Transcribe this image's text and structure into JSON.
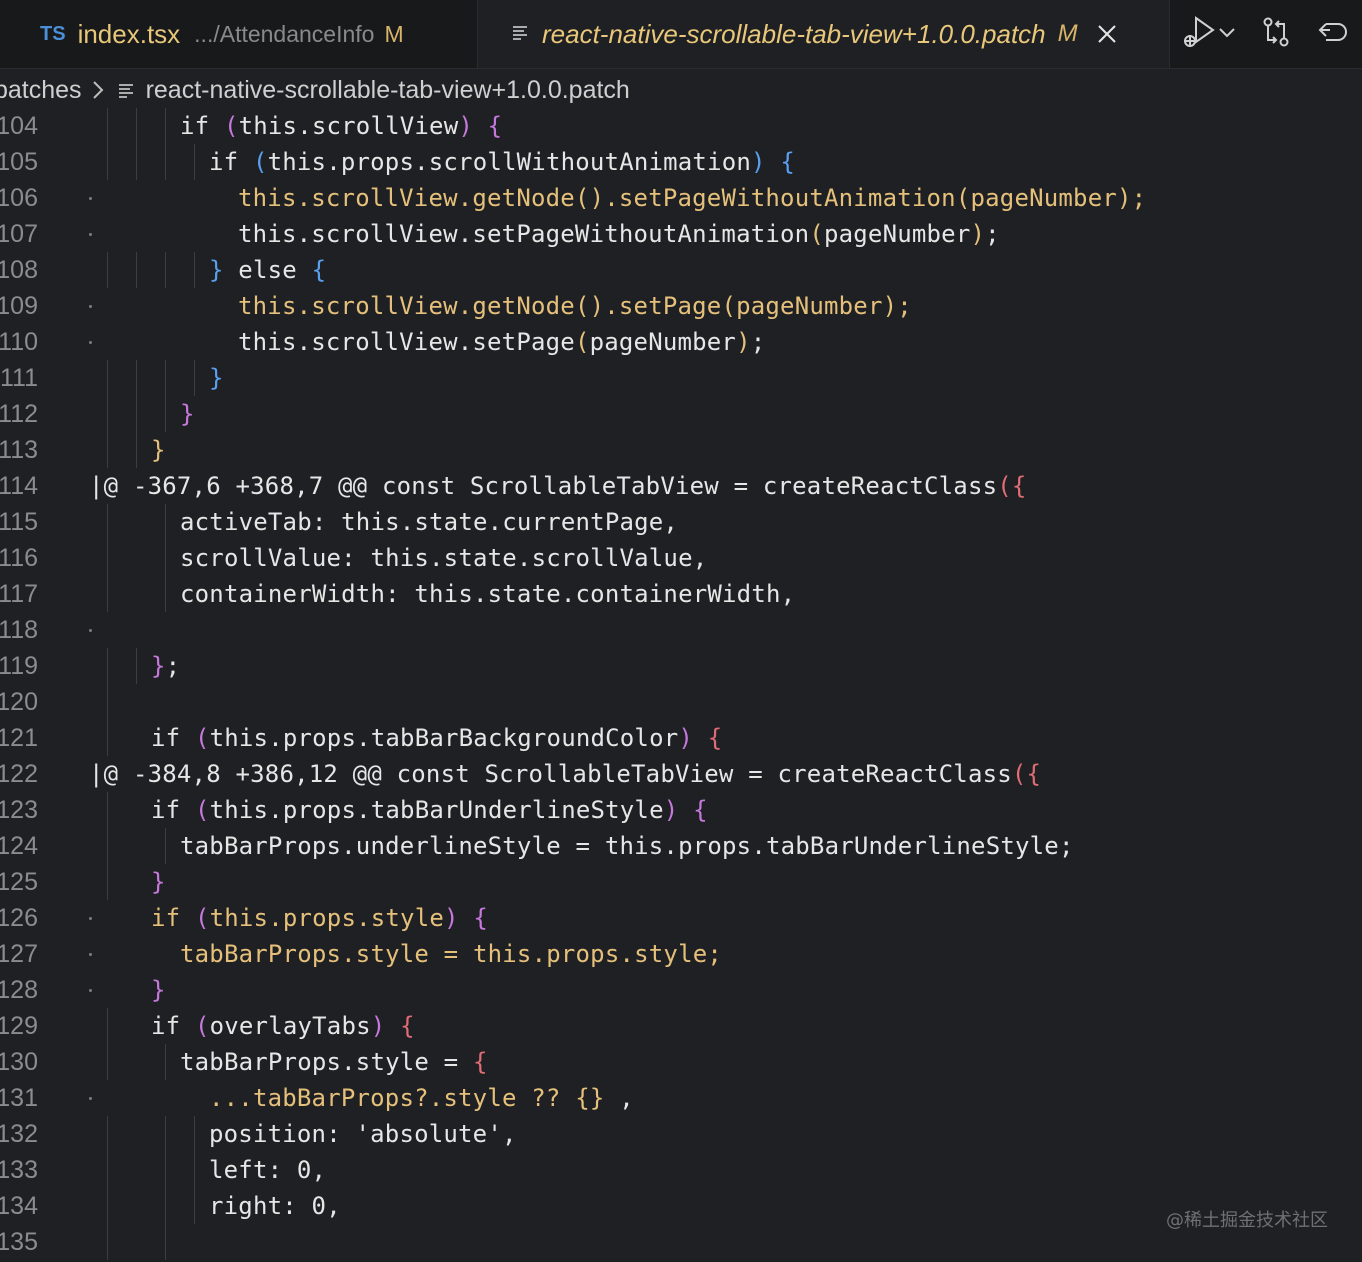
{
  "tabs": [
    {
      "lang_badge": "TS",
      "filename": "index.tsx",
      "path": ".../AttendanceInfo",
      "status": "M",
      "active": false
    },
    {
      "filename": "react-native-scrollable-tab-view+1.0.0.patch",
      "status": "M",
      "active": true
    }
  ],
  "actions": [
    "run-debug-icon",
    "chevron-down-icon",
    "source-control-compare-icon",
    "revert-icon"
  ],
  "breadcrumb": {
    "folder": "patches",
    "file": "react-native-scrollable-tab-view+1.0.0.patch"
  },
  "lines": [
    {
      "n": "104",
      "dot": false,
      "guides": [
        107,
        136,
        165
      ],
      "indent": 180,
      "tokens": [
        {
          "t": "if ",
          "c": "plain"
        },
        {
          "t": "(",
          "c": "pink"
        },
        {
          "t": "this.scrollView",
          "c": "plain"
        },
        {
          "t": ")",
          "c": "pink"
        },
        {
          "t": " ",
          "c": "plain"
        },
        {
          "t": "{",
          "c": "pink"
        }
      ]
    },
    {
      "n": "105",
      "dot": false,
      "guides": [
        107,
        136,
        165,
        194
      ],
      "indent": 209,
      "tokens": [
        {
          "t": "if ",
          "c": "plain"
        },
        {
          "t": "(",
          "c": "blue"
        },
        {
          "t": "this.props.scrollWithoutAnimation",
          "c": "plain"
        },
        {
          "t": ")",
          "c": "blue"
        },
        {
          "t": " ",
          "c": "plain"
        },
        {
          "t": "{",
          "c": "blue"
        }
      ]
    },
    {
      "n": "106",
      "dot": true,
      "guides": [],
      "indent": 238,
      "tokens": [
        {
          "t": "this.scrollView.getNode",
          "c": "yellow"
        },
        {
          "t": "()",
          "c": "yellow"
        },
        {
          "t": ".setPageWithoutAnimation",
          "c": "yellow"
        },
        {
          "t": "(",
          "c": "yellow"
        },
        {
          "t": "pageNumber",
          "c": "yellow"
        },
        {
          "t": ");",
          "c": "yellow"
        }
      ]
    },
    {
      "n": "107",
      "dot": true,
      "guides": [],
      "indent": 238,
      "tokens": [
        {
          "t": "this.scrollView.setPageWithoutAnimation",
          "c": "plain"
        },
        {
          "t": "(",
          "c": "yellow"
        },
        {
          "t": "pageNumber",
          "c": "plain"
        },
        {
          "t": ")",
          "c": "yellow"
        },
        {
          "t": ";",
          "c": "plain"
        }
      ]
    },
    {
      "n": "108",
      "dot": false,
      "guides": [
        107,
        136,
        165,
        194
      ],
      "indent": 209,
      "tokens": [
        {
          "t": "}",
          "c": "blue"
        },
        {
          "t": " else ",
          "c": "plain"
        },
        {
          "t": "{",
          "c": "blue"
        }
      ]
    },
    {
      "n": "109",
      "dot": true,
      "guides": [],
      "indent": 238,
      "tokens": [
        {
          "t": "this.scrollView.getNode",
          "c": "yellow"
        },
        {
          "t": "()",
          "c": "yellow"
        },
        {
          "t": ".setPage",
          "c": "yellow"
        },
        {
          "t": "(",
          "c": "yellow"
        },
        {
          "t": "pageNumber",
          "c": "yellow"
        },
        {
          "t": ");",
          "c": "yellow"
        }
      ]
    },
    {
      "n": "110",
      "dot": true,
      "guides": [],
      "indent": 238,
      "tokens": [
        {
          "t": "this.scrollView.setPage",
          "c": "plain"
        },
        {
          "t": "(",
          "c": "yellow"
        },
        {
          "t": "pageNumber",
          "c": "plain"
        },
        {
          "t": ")",
          "c": "yellow"
        },
        {
          "t": ";",
          "c": "plain"
        }
      ]
    },
    {
      "n": "111",
      "dot": false,
      "guides": [
        107,
        136,
        165,
        194
      ],
      "indent": 209,
      "tokens": [
        {
          "t": "}",
          "c": "blue"
        }
      ]
    },
    {
      "n": "112",
      "dot": false,
      "guides": [
        107,
        136,
        165
      ],
      "indent": 180,
      "tokens": [
        {
          "t": "}",
          "c": "pink"
        }
      ]
    },
    {
      "n": "113",
      "dot": false,
      "guides": [
        107,
        136
      ],
      "indent": 151,
      "tokens": [
        {
          "t": "}",
          "c": "yellow"
        }
      ]
    },
    {
      "n": "114",
      "dot": false,
      "guides": [],
      "indent": 89,
      "tokens": [
        {
          "t": "|@ -367,6 +368,7 @@ const ScrollableTabView = createReactClass",
          "c": "plain"
        },
        {
          "t": "({",
          "c": "red"
        }
      ]
    },
    {
      "n": "115",
      "dot": false,
      "guides": [
        107,
        165
      ],
      "indent": 180,
      "tokens": [
        {
          "t": "activeTab: this.state.currentPage,",
          "c": "plain"
        }
      ]
    },
    {
      "n": "116",
      "dot": false,
      "guides": [
        107,
        165
      ],
      "indent": 180,
      "tokens": [
        {
          "t": "scrollValue: this.state.scrollValue,",
          "c": "plain"
        }
      ]
    },
    {
      "n": "117",
      "dot": false,
      "guides": [
        107,
        165
      ],
      "indent": 180,
      "tokens": [
        {
          "t": "containerWidth: this.state.containerWidth,",
          "c": "plain"
        }
      ]
    },
    {
      "n": "118",
      "dot": true,
      "guides": [],
      "indent": 180,
      "tokens": []
    },
    {
      "n": "119",
      "dot": false,
      "guides": [
        107,
        136
      ],
      "indent": 151,
      "tokens": [
        {
          "t": "}",
          "c": "pink"
        },
        {
          "t": ";",
          "c": "plain"
        }
      ]
    },
    {
      "n": "120",
      "dot": false,
      "guides": [
        107
      ],
      "indent": 151,
      "tokens": []
    },
    {
      "n": "121",
      "dot": false,
      "guides": [
        107
      ],
      "indent": 151,
      "tokens": [
        {
          "t": "if ",
          "c": "plain"
        },
        {
          "t": "(",
          "c": "pink"
        },
        {
          "t": "this.props.tabBarBackgroundColor",
          "c": "plain"
        },
        {
          "t": ")",
          "c": "pink"
        },
        {
          "t": " ",
          "c": "plain"
        },
        {
          "t": "{",
          "c": "red"
        }
      ]
    },
    {
      "n": "122",
      "dot": false,
      "guides": [],
      "indent": 89,
      "tokens": [
        {
          "t": "|@ -384,8 +386,12 @@ const ScrollableTabView = createReactClass",
          "c": "plain"
        },
        {
          "t": "({",
          "c": "red"
        }
      ]
    },
    {
      "n": "123",
      "dot": false,
      "guides": [
        107
      ],
      "indent": 151,
      "tokens": [
        {
          "t": "if ",
          "c": "plain"
        },
        {
          "t": "(",
          "c": "pink"
        },
        {
          "t": "this.props.tabBarUnderlineStyle",
          "c": "plain"
        },
        {
          "t": ")",
          "c": "pink"
        },
        {
          "t": " ",
          "c": "plain"
        },
        {
          "t": "{",
          "c": "pink"
        }
      ]
    },
    {
      "n": "124",
      "dot": false,
      "guides": [
        107,
        165
      ],
      "indent": 180,
      "tokens": [
        {
          "t": "tabBarProps.underlineStyle = this.props.tabBarUnderlineStyle;",
          "c": "plain"
        }
      ]
    },
    {
      "n": "125",
      "dot": false,
      "guides": [
        107
      ],
      "indent": 151,
      "tokens": [
        {
          "t": "}",
          "c": "pink"
        }
      ]
    },
    {
      "n": "126",
      "dot": true,
      "guides": [],
      "indent": 151,
      "tokens": [
        {
          "t": "if ",
          "c": "yellow"
        },
        {
          "t": "(",
          "c": "pink"
        },
        {
          "t": "this.props.style",
          "c": "yellow"
        },
        {
          "t": ")",
          "c": "pink"
        },
        {
          "t": " ",
          "c": "plain"
        },
        {
          "t": "{",
          "c": "pink"
        }
      ]
    },
    {
      "n": "127",
      "dot": true,
      "guides": [],
      "indent": 180,
      "tokens": [
        {
          "t": "tabBarProps.style = this.props.style;",
          "c": "yellow"
        }
      ]
    },
    {
      "n": "128",
      "dot": true,
      "guides": [],
      "indent": 151,
      "tokens": [
        {
          "t": "}",
          "c": "pink"
        }
      ]
    },
    {
      "n": "129",
      "dot": false,
      "guides": [
        107
      ],
      "indent": 151,
      "tokens": [
        {
          "t": "if ",
          "c": "plain"
        },
        {
          "t": "(",
          "c": "pink"
        },
        {
          "t": "overlayTabs",
          "c": "plain"
        },
        {
          "t": ")",
          "c": "pink"
        },
        {
          "t": " ",
          "c": "plain"
        },
        {
          "t": "{",
          "c": "red"
        }
      ]
    },
    {
      "n": "130",
      "dot": false,
      "guides": [
        107,
        165
      ],
      "indent": 180,
      "tokens": [
        {
          "t": "tabBarProps.style = ",
          "c": "plain"
        },
        {
          "t": "{",
          "c": "red"
        }
      ]
    },
    {
      "n": "131",
      "dot": true,
      "guides": [],
      "indent": 209,
      "tokens": [
        {
          "t": "...tabBarProps?.style ?? ",
          "c": "yellow"
        },
        {
          "t": "{}",
          "c": "yellow"
        },
        {
          "t": " ,",
          "c": "plain"
        }
      ]
    },
    {
      "n": "132",
      "dot": false,
      "guides": [
        107,
        165,
        194
      ],
      "indent": 209,
      "tokens": [
        {
          "t": "position: 'absolute',",
          "c": "plain"
        }
      ]
    },
    {
      "n": "133",
      "dot": false,
      "guides": [
        107,
        165,
        194
      ],
      "indent": 209,
      "tokens": [
        {
          "t": "left: 0,",
          "c": "plain"
        }
      ]
    },
    {
      "n": "134",
      "dot": false,
      "guides": [
        107,
        165,
        194
      ],
      "indent": 209,
      "tokens": [
        {
          "t": "right: 0,",
          "c": "plain"
        }
      ]
    },
    {
      "n": "135",
      "dot": false,
      "guides": [
        107,
        165
      ],
      "indent": 209,
      "tokens": []
    }
  ],
  "watermark": "@稀土掘金技术社区"
}
